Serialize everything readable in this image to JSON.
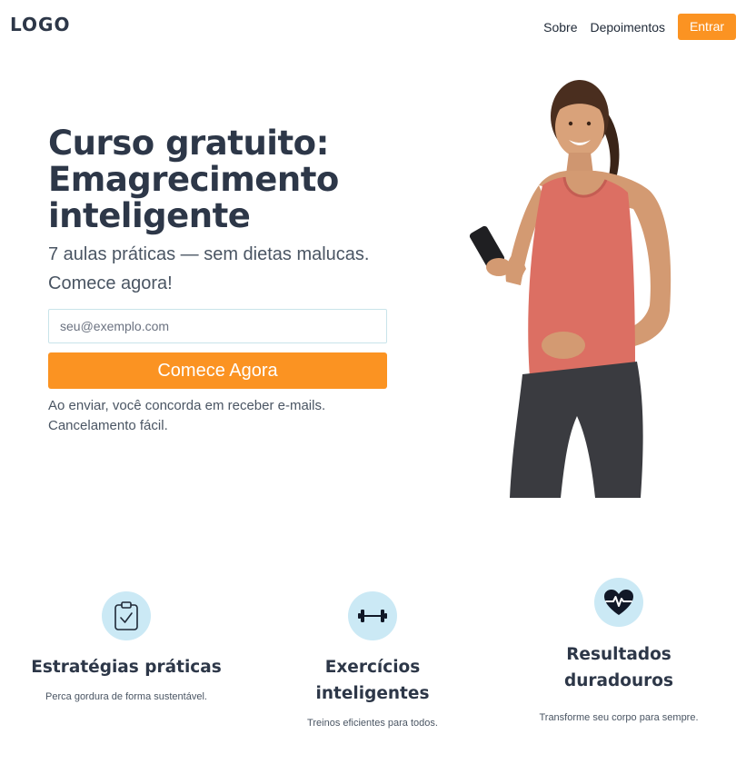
{
  "header": {
    "logo": "LOGO",
    "nav": [
      "Sobre",
      "Depoimentos"
    ],
    "login_label": "Entrar"
  },
  "hero": {
    "title_lines": [
      "Curso gratuito:",
      "Emagrecimento",
      "inteligente"
    ],
    "subtitle": "7 aulas práticas — sem dietas malucas. Comece agora!",
    "email_placeholder": "seu@exemplo.com",
    "cta_label": "Comece Agora",
    "disclaimer": "Ao enviar, você concorda em receber e-mails. Cancelamento fácil."
  },
  "features": [
    {
      "icon": "clipboard-check-icon",
      "title": "Estratégias práticas",
      "description": "Perca gordura de forma sustentável."
    },
    {
      "icon": "dumbbell-icon",
      "title": "Exercícios inteligentes",
      "description": "Treinos eficientes para todos."
    },
    {
      "icon": "heart-pulse-icon",
      "title": "Resultados duradouros",
      "description": "Transforme seu corpo para sempre."
    }
  ],
  "colors": {
    "accent": "#fb9322",
    "heading": "#2d3748",
    "icon_bg": "#cbe9f5"
  }
}
